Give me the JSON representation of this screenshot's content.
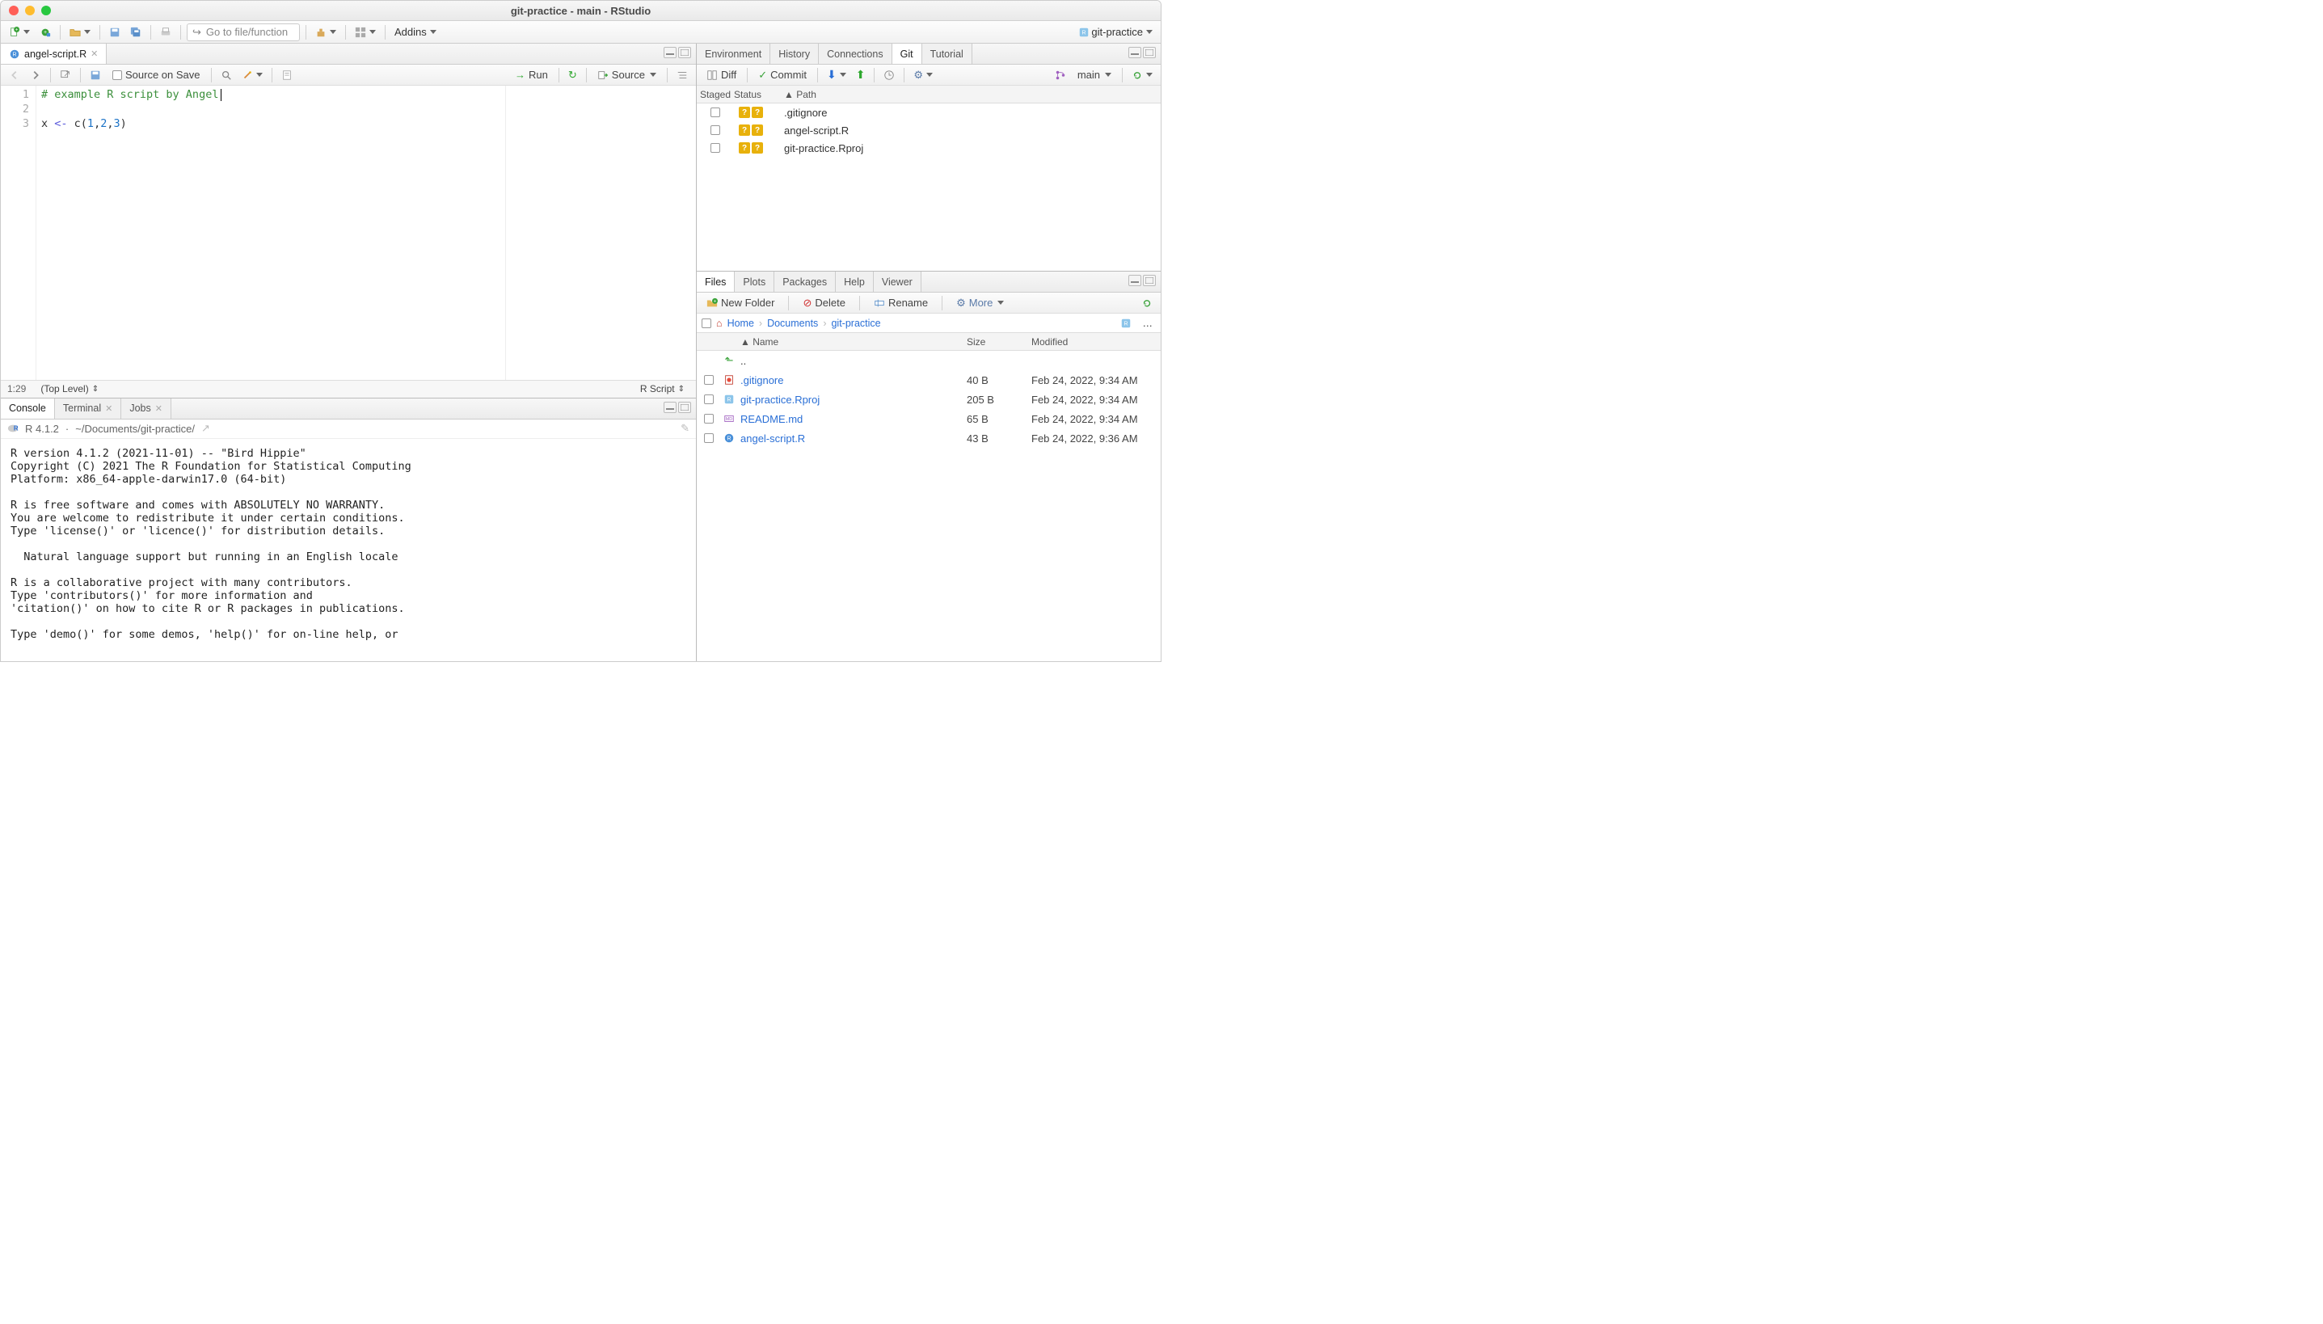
{
  "title": "git-practice - main - RStudio",
  "maintoolbar": {
    "goto_placeholder": "Go to file/function",
    "addins": "Addins",
    "project_name": "git-practice"
  },
  "source": {
    "tab_name": "angel-script.R",
    "source_on_save": "Source on Save",
    "run": "Run",
    "source": "Source",
    "lines": {
      "1": "# example R script by Angel",
      "2": "",
      "3a": "x ",
      "3b": "<-",
      "3c": " c(",
      "3d": "1",
      "3e": ",",
      "3f": "2",
      "3g": ",",
      "3h": "3",
      "3i": ")"
    },
    "status_pos": "1:29",
    "status_scope": "(Top Level)",
    "status_type": "R Script"
  },
  "console": {
    "tab_console": "Console",
    "tab_terminal": "Terminal",
    "tab_jobs": "Jobs",
    "r_version": "R 4.1.2",
    "path": "~/Documents/git-practice/",
    "output": "R version 4.1.2 (2021-11-01) -- \"Bird Hippie\"\nCopyright (C) 2021 The R Foundation for Statistical Computing\nPlatform: x86_64-apple-darwin17.0 (64-bit)\n\nR is free software and comes with ABSOLUTELY NO WARRANTY.\nYou are welcome to redistribute it under certain conditions.\nType 'license()' or 'licence()' for distribution details.\n\n  Natural language support but running in an English locale\n\nR is a collaborative project with many contributors.\nType 'contributors()' for more information and\n'citation()' on how to cite R or R packages in publications.\n\nType 'demo()' for some demos, 'help()' for on-line help, or"
  },
  "env_pane": {
    "tabs": {
      "environment": "Environment",
      "history": "History",
      "connections": "Connections",
      "git": "Git",
      "tutorial": "Tutorial"
    }
  },
  "git": {
    "diff": "Diff",
    "commit": "Commit",
    "branch": "main",
    "hdr_staged": "Staged",
    "hdr_status": "Status",
    "hdr_path": "Path",
    "rows": [
      {
        "path": ".gitignore"
      },
      {
        "path": "angel-script.R"
      },
      {
        "path": "git-practice.Rproj"
      }
    ]
  },
  "files_pane": {
    "tabs": {
      "files": "Files",
      "plots": "Plots",
      "packages": "Packages",
      "help": "Help",
      "viewer": "Viewer"
    },
    "new_folder": "New Folder",
    "delete": "Delete",
    "rename": "Rename",
    "more": "More",
    "breadcrumbs": {
      "home": "Home",
      "documents": "Documents",
      "project": "git-practice"
    },
    "hdr_name": "Name",
    "hdr_size": "Size",
    "hdr_modified": "Modified",
    "up": "..",
    "rows": [
      {
        "name": ".gitignore",
        "size": "40 B",
        "modified": "Feb 24, 2022, 9:34 AM",
        "icon": "git"
      },
      {
        "name": "git-practice.Rproj",
        "size": "205 B",
        "modified": "Feb 24, 2022, 9:34 AM",
        "icon": "rproj"
      },
      {
        "name": "README.md",
        "size": "65 B",
        "modified": "Feb 24, 2022, 9:34 AM",
        "icon": "md"
      },
      {
        "name": "angel-script.R",
        "size": "43 B",
        "modified": "Feb 24, 2022, 9:36 AM",
        "icon": "r"
      }
    ]
  }
}
